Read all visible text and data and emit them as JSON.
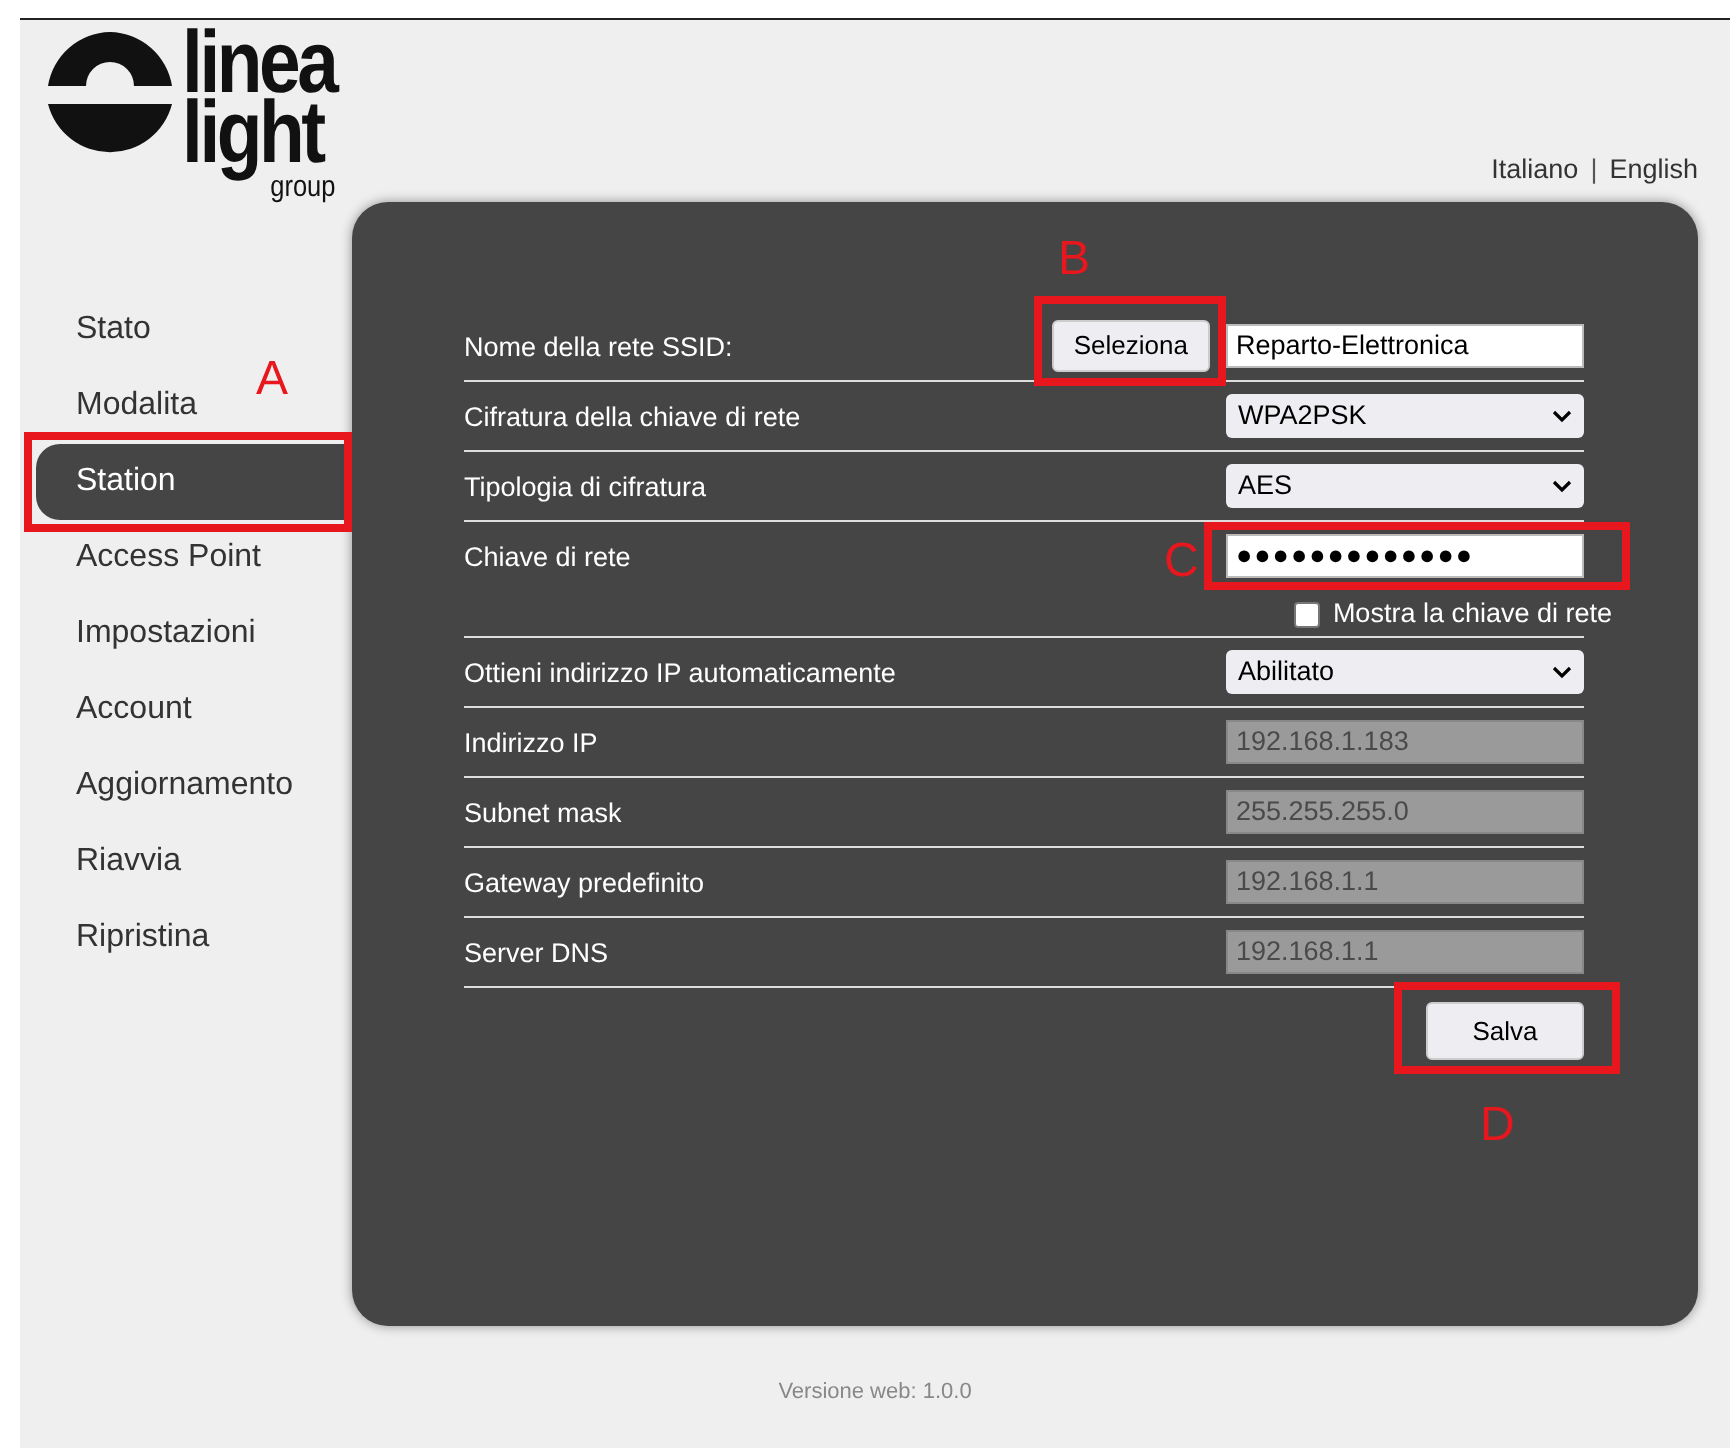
{
  "logo": {
    "line_1": "linea",
    "line_2": "light",
    "line_3": "group"
  },
  "languages": [
    {
      "label": "Italiano",
      "kind": "link"
    },
    {
      "label": "|",
      "kind": "separator"
    },
    {
      "label": "English",
      "kind": "link"
    }
  ],
  "sidebar": {
    "items": [
      {
        "label": "Stato",
        "selected": false
      },
      {
        "label": "Modalita",
        "selected": false
      },
      {
        "label": "Station",
        "selected": true
      },
      {
        "label": "Access Point",
        "selected": false
      },
      {
        "label": "Impostazioni",
        "selected": false
      },
      {
        "label": "Account",
        "selected": false
      },
      {
        "label": "Aggiornamento",
        "selected": false
      },
      {
        "label": "Riavvia",
        "selected": false
      },
      {
        "label": "Ripristina",
        "selected": false
      }
    ]
  },
  "form": {
    "rows": [
      {
        "kind": "text",
        "label": "Nome della rete SSID:",
        "button": "Seleziona",
        "value": "Reparto-Elettronica"
      },
      {
        "kind": "select",
        "label": "Cifratura della chiave di rete",
        "value": "WPA2PSK"
      },
      {
        "kind": "select",
        "label": "Tipologia di cifratura",
        "value": "AES"
      },
      {
        "kind": "password",
        "label": "Chiave di rete",
        "value": "●●●●●●●●●●●●●",
        "checkbox": {
          "label": "Mostra la chiave di rete",
          "checked": false
        }
      },
      {
        "kind": "select",
        "label": "Ottieni indirizzo IP automaticamente",
        "value": "Abilitato"
      },
      {
        "kind": "disabled",
        "label": "Indirizzo IP",
        "value": "192.168.1.183"
      },
      {
        "kind": "disabled",
        "label": "Subnet mask",
        "value": "255.255.255.0"
      },
      {
        "kind": "disabled",
        "label": "Gateway predefinito",
        "value": "192.168.1.1"
      },
      {
        "kind": "disabled",
        "label": "Server DNS",
        "value": "192.168.1.1"
      }
    ],
    "save_button": "Salva"
  },
  "footer": "Versione web: 1.0.0",
  "annotations": [
    {
      "label": "A"
    },
    {
      "label": "B"
    },
    {
      "label": "C"
    },
    {
      "label": "D"
    }
  ]
}
